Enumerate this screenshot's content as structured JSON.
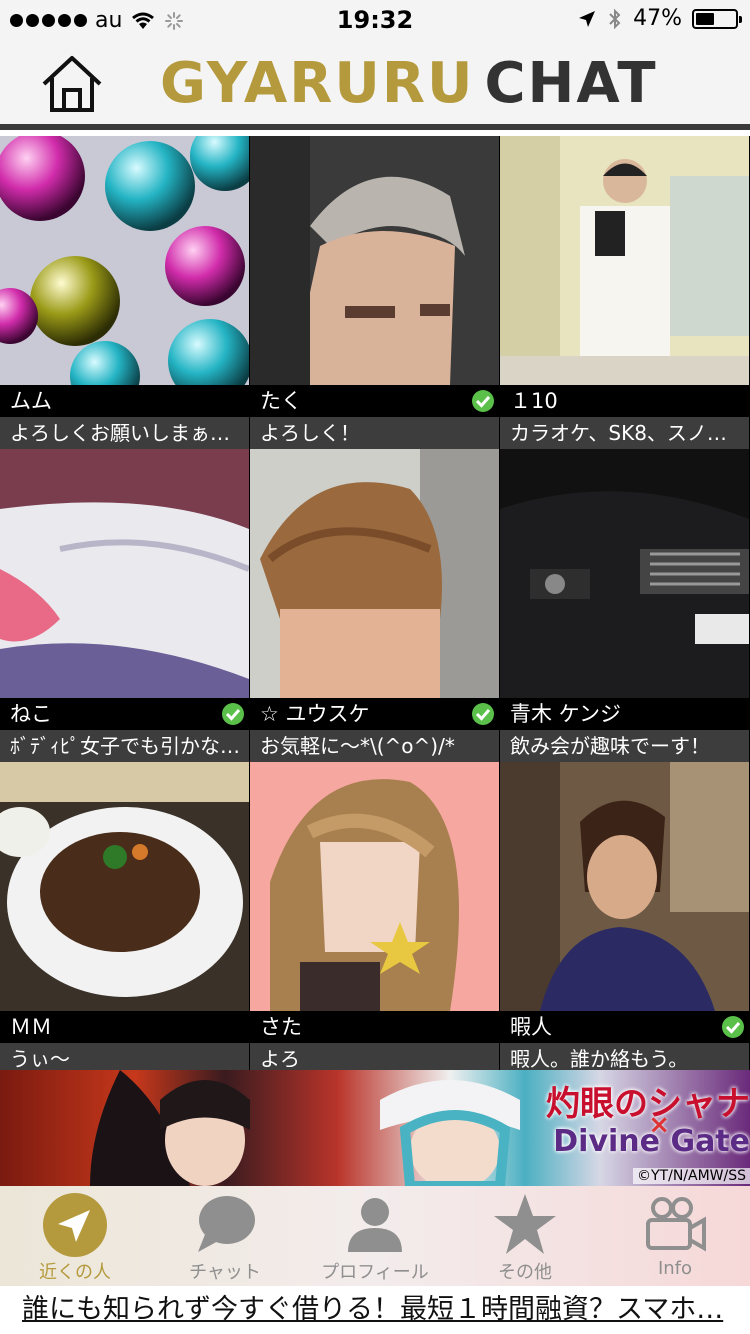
{
  "status_bar": {
    "carrier": "au",
    "time": "19:32",
    "battery": "47%",
    "battery_level": 0.47
  },
  "header": {
    "brand_part1": "GYARURU",
    "brand_part2": "CHAT"
  },
  "users": [
    {
      "name": "ムム",
      "message": "よろしくお願いしまぁ…",
      "verified": false
    },
    {
      "name": "たく",
      "message": "よろしく！",
      "verified": true
    },
    {
      "name": "１10",
      "message": "カラオケ、SK8、スノ…",
      "verified": false
    },
    {
      "name": "ねこ",
      "message": "ﾎﾞﾃﾞｨﾋﾟ女子でも引かな…",
      "verified": true
    },
    {
      "name": "☆ ユウスケ",
      "message": "お気軽に〜*\\(^o^)/*",
      "verified": true
    },
    {
      "name": "青木 ケンジ",
      "message": "飲み会が趣味でーす！",
      "verified": false
    },
    {
      "name": "ＭＭ",
      "message": "うぃ〜",
      "verified": false
    },
    {
      "name": "さた",
      "message": "よろ",
      "verified": false
    },
    {
      "name": "暇人",
      "message": "暇人。誰か絡もう。",
      "verified": true
    }
  ],
  "ad_banner": {
    "title1": "灼眼のシャナ",
    "cross": "×",
    "title2": "Divine Gate",
    "copyright": "©YT/N/AMW/SS"
  },
  "tabs": [
    {
      "label": "近くの人",
      "icon": "location-arrow-icon",
      "active": true
    },
    {
      "label": "チャット",
      "icon": "chat-bubble-icon",
      "active": false
    },
    {
      "label": "プロフィール",
      "icon": "person-icon",
      "active": false
    },
    {
      "label": "その他",
      "icon": "star-icon",
      "active": false
    },
    {
      "label": "Info",
      "icon": "video-camera-icon",
      "active": false
    }
  ],
  "bottom_ad": {
    "text": "誰にも知られず今すぐ借りる！最短１時間融資？スマホ…"
  },
  "colors": {
    "brand_gold": "#b49a3c",
    "brand_dark": "#333333",
    "verified_green": "#5ac04a"
  }
}
